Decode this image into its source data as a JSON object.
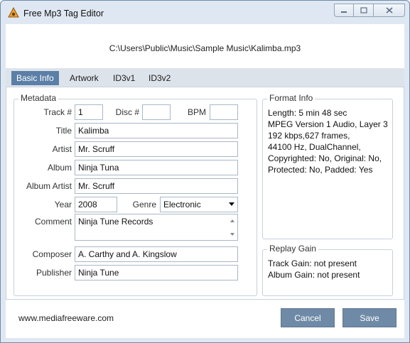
{
  "window": {
    "title": "Free Mp3 Tag Editor"
  },
  "file_path": "C:\\Users\\Public\\Music\\Sample Music\\Kalimba.mp3",
  "tabs": [
    {
      "label": "Basic Info",
      "active": true
    },
    {
      "label": "Artwork",
      "active": false
    },
    {
      "label": "ID3v1",
      "active": false
    },
    {
      "label": "ID3v2",
      "active": false
    }
  ],
  "metadata": {
    "legend": "Metadata",
    "track_label": "Track #",
    "track_value": "1",
    "disc_label": "Disc #",
    "disc_value": "",
    "bpm_label": "BPM",
    "bpm_value": "",
    "title_label": "Title",
    "title_value": "Kalimba",
    "artist_label": "Artist",
    "artist_value": "Mr. Scruff",
    "album_label": "Album",
    "album_value": "Ninja Tuna",
    "album_artist_label": "Album Artist",
    "album_artist_value": "Mr. Scruff",
    "year_label": "Year",
    "year_value": "2008",
    "genre_label": "Genre",
    "genre_value": "Electronic",
    "comment_label": "Comment",
    "comment_value": "Ninja Tune Records",
    "composer_label": "Composer",
    "composer_value": "A. Carthy and A. Kingslow",
    "publisher_label": "Publisher",
    "publisher_value": "Ninja Tune"
  },
  "format_info": {
    "legend": "Format Info",
    "lines": [
      "Length: 5 min 48 sec",
      "MPEG Version 1 Audio, Layer 3",
      "192 kbps,627 frames,",
      "44100 Hz, DualChannel,",
      "Copyrighted: No, Original: No,",
      "Protected: No, Padded: Yes"
    ]
  },
  "replay_gain": {
    "legend": "Replay Gain",
    "lines": [
      "Track Gain: not present",
      "Album Gain: not present"
    ]
  },
  "footer": {
    "website": "www.mediafreeware.com",
    "cancel_label": "Cancel",
    "save_label": "Save"
  },
  "colors": {
    "accent": "#5b7fa6",
    "button": "#6f8aa6",
    "frame": "#dfe8f2"
  },
  "icons": {
    "app": "app-logo-icon",
    "minimize": "minimize-icon",
    "maximize": "maximize-icon",
    "close": "close-icon"
  }
}
